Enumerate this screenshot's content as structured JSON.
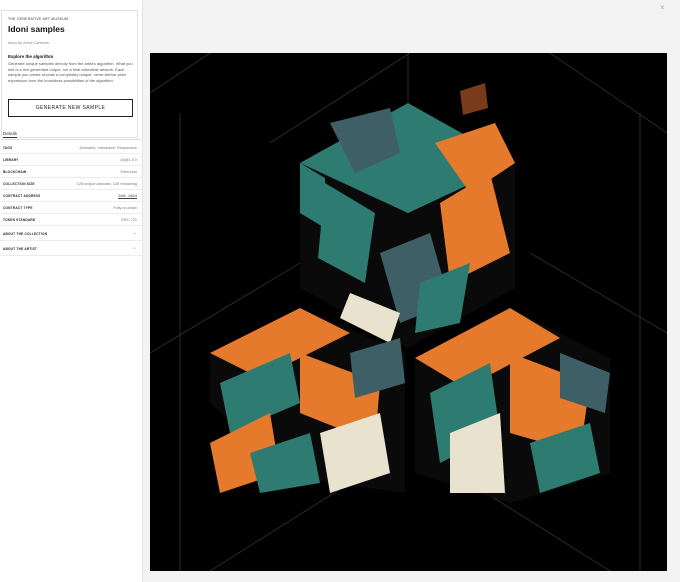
{
  "museum_label": "THE GENERATIVE ART MUSEUM",
  "title": "Idoni samples",
  "byline": "Idoni by Anna Carreras",
  "explore": {
    "heading": "Explore the algorithm",
    "description": "Generate unique samples directly from the artist's algorithm. What you see is a live-generated output, not a final collectible artwork. Each sample you create reveals a completely unique, never-before-seen expression from the boundless possibilities of the algorithm."
  },
  "generate_button": "GENERATE NEW SAMPLE",
  "tabs": [
    "Details"
  ],
  "details": [
    {
      "key": "TAGS",
      "value": "Animated, Interactive, Responsive"
    },
    {
      "key": "LIBRARY",
      "value": "p5@1.0.0"
    },
    {
      "key": "BLOCKCHAIN",
      "value": "Ethereum"
    },
    {
      "key": "COLLECTION SIZE",
      "value": "128 unique artworks, 128 remaining"
    },
    {
      "key": "CONTRACT ADDRESS",
      "value": "0x9f...b624"
    },
    {
      "key": "CONTRACT TYPE",
      "value": "Fully on-chain"
    },
    {
      "key": "TOKEN STANDARD",
      "value": "ERC-721"
    }
  ],
  "accordions": [
    "ABOUT THE COLLECTION",
    "ABOUT THE ARTIST"
  ],
  "close_symbol": "×",
  "chevron_symbol": "⌄",
  "artwork_colors": {
    "background": "#000000",
    "teal": "#2e7b72",
    "orange": "#e57a2c",
    "brown": "#7a3b1a",
    "cream": "#e8e2cf",
    "slate": "#3f5f66"
  }
}
